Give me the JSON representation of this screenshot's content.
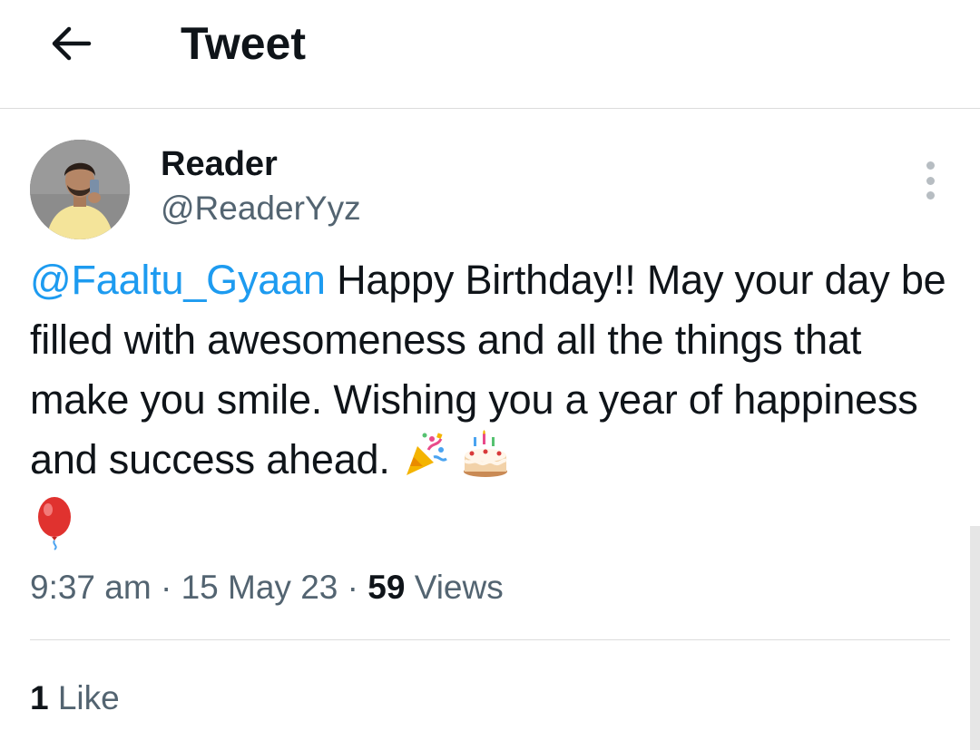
{
  "header": {
    "title": "Tweet",
    "back_icon": "arrow-left-icon"
  },
  "author": {
    "name": "Reader",
    "handle": "@ReaderYyz",
    "avatar_icon": "avatar"
  },
  "tweet": {
    "mention": "@Faaltu_Gyaan",
    "text": " Happy Birthday!! May your day be filled with awesomeness and all the things that make you smile. Wishing you a year of happiness and success ahead. ",
    "emojis": [
      "party-popper-icon",
      "birthday-cake-icon",
      "balloon-icon"
    ]
  },
  "meta": {
    "time": "9:37 am",
    "date": "15 May 23",
    "separator": "·",
    "views_count": "59",
    "views_label": "Views"
  },
  "engagement": {
    "like_count": "1",
    "like_label": "Like"
  },
  "colors": {
    "link": "#1d9bf0",
    "secondary_text": "#536471",
    "primary_text": "#0f1419",
    "divider": "#dcdcdc"
  }
}
